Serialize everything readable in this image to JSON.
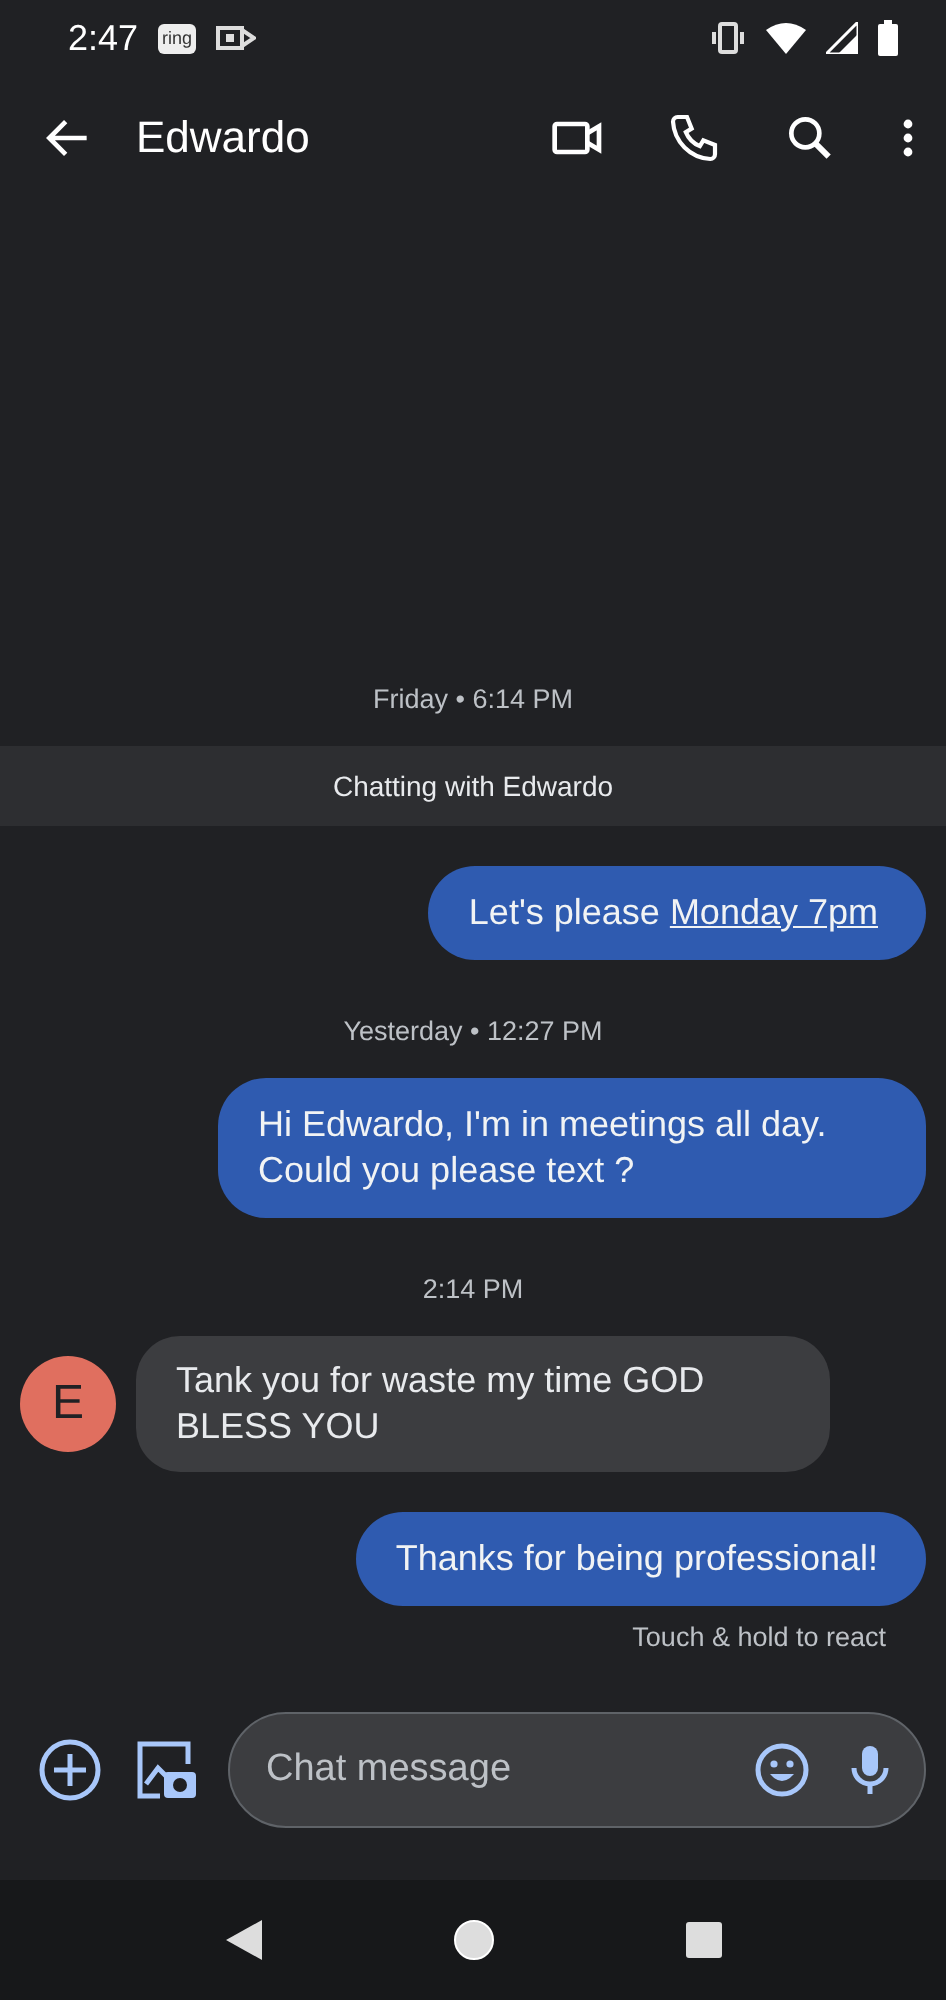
{
  "status_bar": {
    "time": "2:47",
    "ring_logo": "ring"
  },
  "header": {
    "title": "Edwardo"
  },
  "conversation": [
    {
      "kind": "timestamp",
      "text": "Friday • 6:14 PM"
    },
    {
      "kind": "banner",
      "text": "Chatting with Edwardo"
    },
    {
      "kind": "outgoing",
      "text": "Let's please ",
      "link": "Monday 7pm"
    },
    {
      "kind": "timestamp",
      "text": "Yesterday • 12:27 PM"
    },
    {
      "kind": "outgoing",
      "text": "Hi Edwardo, I'm in meetings all day. Could you please text ?"
    },
    {
      "kind": "timestamp",
      "text": "2:14 PM"
    },
    {
      "kind": "incoming",
      "avatar": "E",
      "text": "Tank you  for waste my time GOD BLESS YOU"
    },
    {
      "kind": "outgoing",
      "text": "Thanks for being professional!",
      "hint": "Touch & hold to react"
    }
  ],
  "composer": {
    "placeholder": "Chat message"
  }
}
